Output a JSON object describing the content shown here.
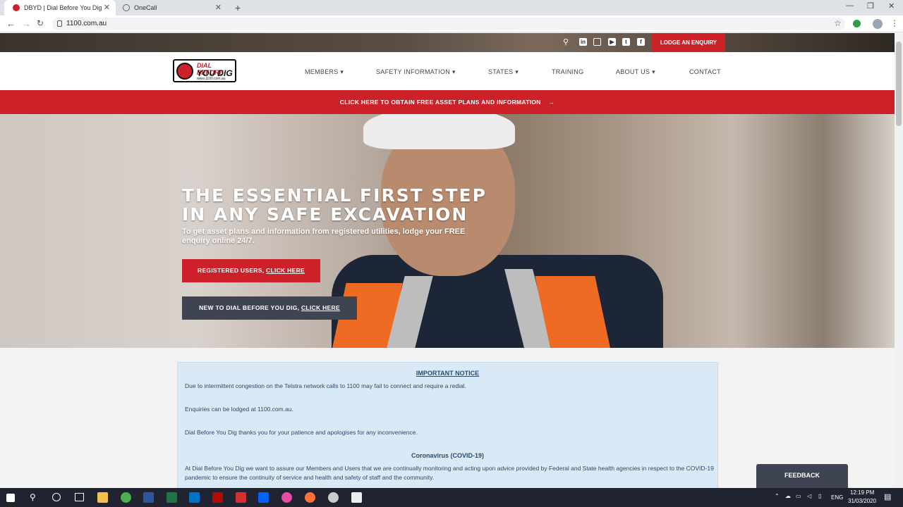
{
  "browser": {
    "tabs": [
      {
        "title": "DBYD | Dial Before You Dig",
        "active": true
      },
      {
        "title": "OneCall",
        "active": false
      }
    ],
    "url": "1100.com.au"
  },
  "topbar": {
    "social_icons": [
      "search-icon",
      "linkedin-icon",
      "instagram-icon",
      "youtube-icon",
      "twitter-icon",
      "facebook-icon"
    ],
    "lodge_label": "LODGE AN ENQUIRY"
  },
  "nav": {
    "logo": {
      "line1": "DIAL BEFORE",
      "line2": "YOU DIG",
      "line3": "www.1100.com.au"
    },
    "items": [
      {
        "label": "MEMBERS",
        "dropdown": true
      },
      {
        "label": "SAFETY INFORMATION",
        "dropdown": true
      },
      {
        "label": "STATES",
        "dropdown": true
      },
      {
        "label": "TRAINING",
        "dropdown": false
      },
      {
        "label": "ABOUT US",
        "dropdown": true
      },
      {
        "label": "CONTACT",
        "dropdown": false
      }
    ]
  },
  "banner": {
    "label": "CLICK HERE TO OBTAIN FREE ASSET PLANS AND INFORMATION",
    "arrow": "→"
  },
  "hero": {
    "title_line1": "THE ESSENTIAL FIRST STEP",
    "title_line2": "IN ANY SAFE EXCAVATION",
    "subtitle": "To get asset plans and information from registered utilities, lodge your FREE enquiry online 24/7.",
    "btn_registered": {
      "prefix": "REGISTERED USERS, ",
      "link": "CLICK HERE"
    },
    "btn_new": {
      "prefix": "NEW TO DIAL BEFORE YOU DIG, ",
      "link": "CLICK HERE"
    }
  },
  "notice": {
    "heading": "IMPORTANT NOTICE",
    "p1": "Due to intermittent congestion on the Telstra network calls to 1100 may fail to connect and require a redial.",
    "p2": "Enquiries can be lodged at 1100.com.au.",
    "p3": "Dial Before You Dig thanks you for your patience and apologises for any inconvenience.",
    "covid_heading": "Coronavirus (COVID-19)",
    "covid_text": "At Dial Before You Dig we want to assure our Members and Users that we are continually monitoring and acting upon advice provided by Federal and State health agencies in respect to the COVID-19 pandemic to ensure the continuity of service and health and safety of staff and the community."
  },
  "feedback_label": "FEEDBACK",
  "taskbar": {
    "language": "ENG",
    "time": "12:19 PM",
    "date": "31/03/2020"
  },
  "colors": {
    "brand_red": "#cc2129",
    "dark_button": "#3e4451",
    "notice_bg": "#d9e9f5"
  }
}
